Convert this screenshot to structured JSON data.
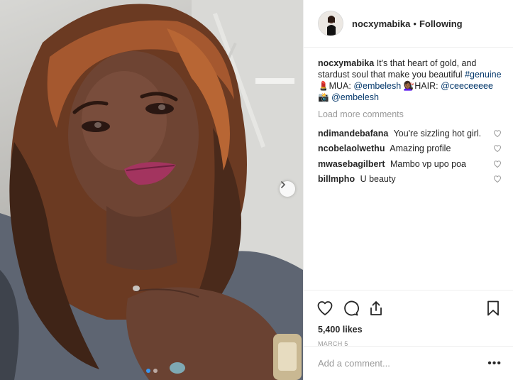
{
  "post": {
    "username": "nocxymabika",
    "separator": "•",
    "follow_state": "Following",
    "caption": {
      "username": "nocxymabika",
      "text_1": "It's that heart of gold, and stardust soul that make you beautiful",
      "hashtag": "#genuine",
      "text_2": "💄MUA:",
      "mention_1": "@embelesh",
      "text_3": "💇🏾‍♀️HAIR:",
      "mention_2": "@ceeceeeee",
      "text_4": "📸",
      "mention_3": "@embelesh"
    },
    "load_more": "Load more comments",
    "comments": [
      {
        "username": "ndimandebafana",
        "text": "You're sizzling hot girl."
      },
      {
        "username": "ncobelaolwethu",
        "text": "Amazing profile"
      },
      {
        "username": "mwasebagilbert",
        "text": "Mambo vp upo poa"
      },
      {
        "username": "billmpho",
        "text": "U beauty"
      }
    ],
    "likes": "5,400 likes",
    "date": "MARCH 5",
    "add_comment_placeholder": "Add a comment...",
    "more_glyph": "•••",
    "carousel": {
      "slides": 2,
      "active_index": 0
    },
    "colors": {
      "link": "#003569",
      "muted": "#999999",
      "active_dot": "#3897f0"
    },
    "icons": [
      "heart-icon",
      "comment-icon",
      "share-icon",
      "bookmark-icon",
      "chevron-right-icon",
      "more-icon"
    ]
  }
}
